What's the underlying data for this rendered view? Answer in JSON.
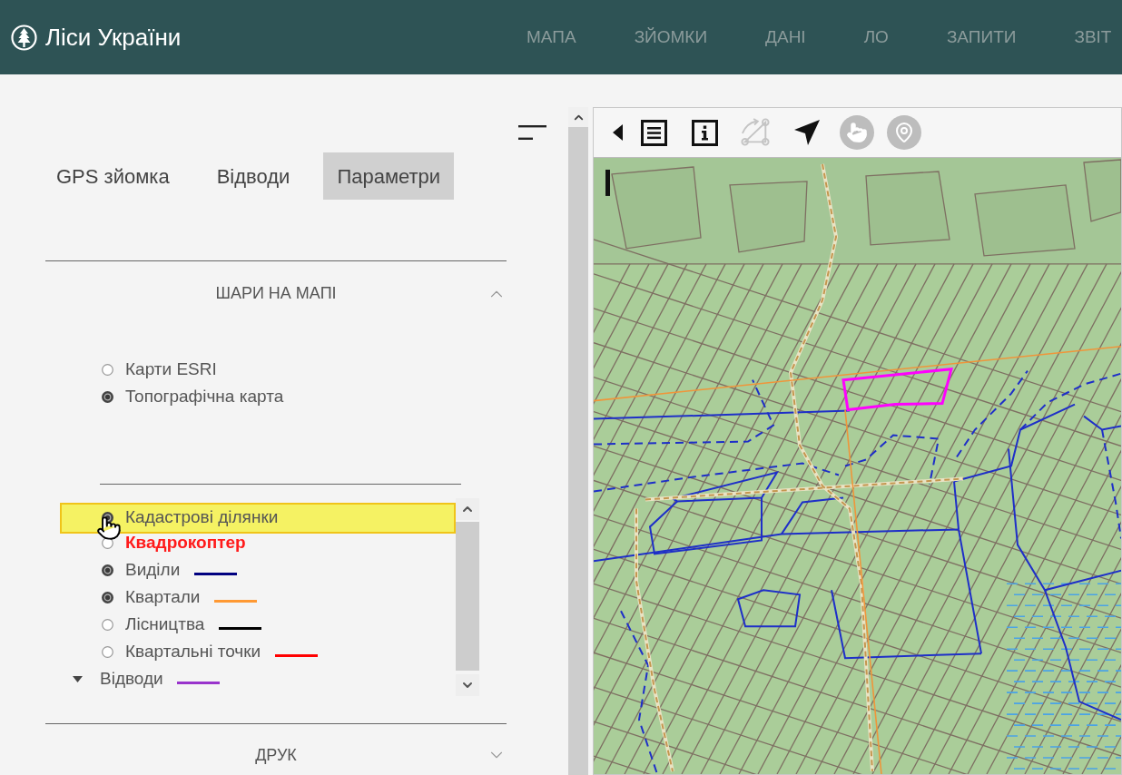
{
  "header": {
    "title": "Ліси України",
    "nav": [
      {
        "label": "МАПА"
      },
      {
        "label": "ЗЙОМКИ"
      },
      {
        "label": "ДАНІ"
      },
      {
        "label": "ЛО"
      },
      {
        "label": "ЗАПИТИ"
      },
      {
        "label": "ЗВІТ"
      }
    ]
  },
  "sidebar": {
    "tabs": [
      {
        "label": "GPS зйомка",
        "selected": false
      },
      {
        "label": "Відводи",
        "selected": false
      },
      {
        "label": "Параметри",
        "selected": true
      }
    ],
    "layers": {
      "title": "ШАРИ НА МАПІ",
      "expanded": true,
      "base_maps": [
        {
          "label": "Карти ESRI",
          "selected": false
        },
        {
          "label": "Топографічна карта",
          "selected": true
        }
      ],
      "overlays": [
        {
          "kind": "layer",
          "label": "Кадастрові ділянки",
          "checked": true,
          "highlighted": true
        },
        {
          "kind": "alert",
          "label": "Квадрокоптер",
          "checked": false,
          "highlighted": false
        },
        {
          "kind": "layer",
          "label": "Виділи",
          "checked": true,
          "highlighted": false,
          "color": "#000080"
        },
        {
          "kind": "layer",
          "label": "Квартали",
          "checked": true,
          "highlighted": false,
          "color": "#ff9933"
        },
        {
          "kind": "layer",
          "label": "Лісництва",
          "checked": false,
          "highlighted": false,
          "color": "#000000"
        },
        {
          "kind": "layer",
          "label": "Квартальні точки",
          "checked": false,
          "highlighted": false,
          "color": "#ff0000"
        },
        {
          "kind": "group",
          "label": "Відводи",
          "expanded": true,
          "highlighted": false,
          "color": "#9933cc"
        }
      ]
    },
    "print": {
      "title": "ДРУК",
      "expanded": false
    }
  },
  "map": {
    "toolbar": [
      {
        "kind": "collapse",
        "disabled": false,
        "active": false
      },
      {
        "kind": "legend",
        "disabled": false,
        "active": false
      },
      {
        "kind": "info",
        "disabled": false,
        "active": false
      },
      {
        "kind": "measure",
        "disabled": true,
        "active": false
      },
      {
        "kind": "select",
        "disabled": false,
        "active": false
      },
      {
        "kind": "pan",
        "disabled": false,
        "active": true
      },
      {
        "kind": "marker",
        "disabled": false,
        "active": true
      }
    ]
  }
}
